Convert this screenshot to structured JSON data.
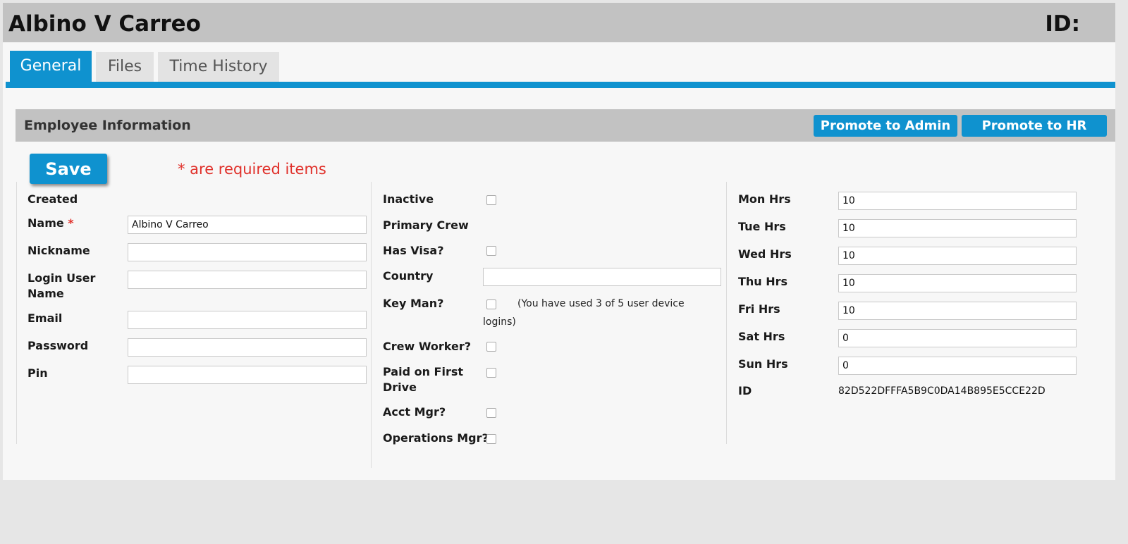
{
  "header": {
    "employee_name": "Albino V Carreo",
    "id_label": "ID:"
  },
  "tabs": [
    {
      "label": "General",
      "active": true
    },
    {
      "label": "Files",
      "active": false
    },
    {
      "label": "Time History",
      "active": false
    }
  ],
  "section": {
    "title": "Employee Information",
    "promote_admin_label": "Promote to Admin",
    "promote_hr_label": "Promote to HR"
  },
  "form": {
    "save_label": "Save",
    "required_note": "* are required items",
    "required_star": "*",
    "left": {
      "created_label": "Created",
      "name_label": "Name",
      "name_value": "Albino V Carreo",
      "nickname_label": "Nickname",
      "nickname_value": "",
      "login_label_line1": "Login User",
      "login_label_line2": "Name",
      "login_value": "",
      "email_label": "Email",
      "email_value": "",
      "password_label": "Password",
      "password_value": "",
      "pin_label": "Pin",
      "pin_value": ""
    },
    "middle": {
      "inactive_label": "Inactive",
      "primary_crew_label": "Primary Crew",
      "has_visa_label": "Has Visa?",
      "country_label": "Country",
      "country_value": "",
      "key_man_label": "Key Man?",
      "device_note_line1": "(You have used 3 of 5 user device",
      "device_note_line2": "logins)",
      "crew_worker_label": "Crew Worker?",
      "paid_label_line1": "Paid on First",
      "paid_label_line2": "Drive",
      "acct_mgr_label": "Acct Mgr?",
      "ops_mgr_label": "Operations Mgr?"
    },
    "right": {
      "mon_label": "Mon Hrs",
      "mon_value": "10",
      "tue_label": "Tue Hrs",
      "tue_value": "10",
      "wed_label": "Wed Hrs",
      "wed_value": "10",
      "thu_label": "Thu Hrs",
      "thu_value": "10",
      "fri_label": "Fri Hrs",
      "fri_value": "10",
      "sat_label": "Sat Hrs",
      "sat_value": "0",
      "sun_label": "Sun Hrs",
      "sun_value": "0",
      "id_label": "ID",
      "id_value": "82D522DFFFA5B9C0DA14B895E5CCE22D"
    }
  },
  "colors": {
    "accent": "#0f92cf",
    "required": "#e0302a",
    "header_gray": "#c2c2c2"
  }
}
